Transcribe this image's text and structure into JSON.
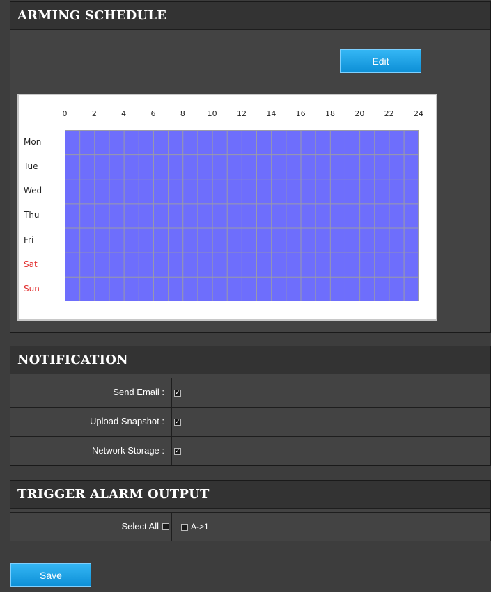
{
  "arming": {
    "title": "ARMING SCHEDULE",
    "edit_label": "Edit",
    "hours": [
      "0",
      "2",
      "4",
      "6",
      "8",
      "10",
      "12",
      "14",
      "16",
      "18",
      "20",
      "22",
      "24"
    ],
    "days": [
      "Mon",
      "Tue",
      "Wed",
      "Thu",
      "Fri",
      "Sat",
      "Sun"
    ],
    "weekend_color": "#e23030",
    "schedule_color": "#6e6efc"
  },
  "notification": {
    "title": "NOTIFICATION",
    "rows": [
      {
        "label": "Send Email :",
        "checked": true
      },
      {
        "label": "Upload Snapshot :",
        "checked": true
      },
      {
        "label": "Network Storage :",
        "checked": true
      }
    ]
  },
  "trigger": {
    "title": "TRIGGER ALARM OUTPUT",
    "select_all_label": "Select All",
    "output_label": "A->1"
  },
  "save_label": "Save",
  "accent": "#1a9ee6"
}
